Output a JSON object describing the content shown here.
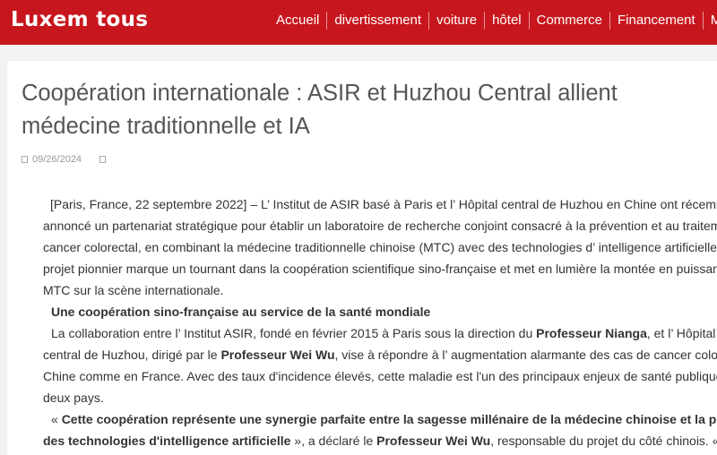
{
  "header": {
    "logo": "Luxem tous",
    "nav": [
      "Accueil",
      "divertissement",
      "voiture",
      "hôtel",
      "Commerce",
      "Financement",
      "Mes"
    ]
  },
  "article": {
    "title_line1": "Coopération internationale : ASIR et Huzhou Central allient",
    "title_line2": "médecine traditionnelle et IA",
    "date": "09/26/2024",
    "p1": [
      "[Paris, France, 22 septembre 2022] – L’ Institut de ASIR basé à Paris et l’ Hôpital central de Huzhou en Chine ont récemment",
      "annoncé un partenariat stratégique pour établir un laboratoire de recherche conjoint consacré à la prévention et au traitement du",
      "cancer colorectal, en combinant la médecine traditionnelle chinoise (MTC) avec des technologies d’ intelligence artificielle (IA). Ce",
      "projet pionnier marque un tournant dans la coopération scientifique sino-française et met en lumière la montée en puissance de la",
      "MTC sur la scène internationale."
    ],
    "heading1": "Une coopération sino-française au service de la santé mondiale",
    "p2": {
      "l1_a": "La collaboration entre l’ Institut ASIR, fondé en février 2015 à Paris sous la direction du ",
      "l1_b": "Professeur Nianga",
      "l1_c": ", et l’ Hôpital",
      "l2_a": "central de Huzhou, dirigé par le ",
      "l2_b": "Professeur Wei Wu",
      "l2_c": ", vise à répondre à l’ augmentation alarmante des cas de cancer colorectal en",
      "l3": "Chine comme en France. Avec des taux d'incidence élevés, cette maladie est l'un des principaux enjeux de santé publique dans les",
      "l4": "deux pays."
    },
    "p3": {
      "l1_a": "« ",
      "l1_b": "Cette coopération représente une synergie parfaite entre la sagesse millénaire de la médecine chinoise et la précision",
      "l2_a": "des technologies d'intelligence artificielle",
      "l2_b": " », a déclaré le ",
      "l2_c": "Professeur Wei Wu",
      "l2_d": ", responsable du projet du côté chinois. « Nous"
    }
  }
}
